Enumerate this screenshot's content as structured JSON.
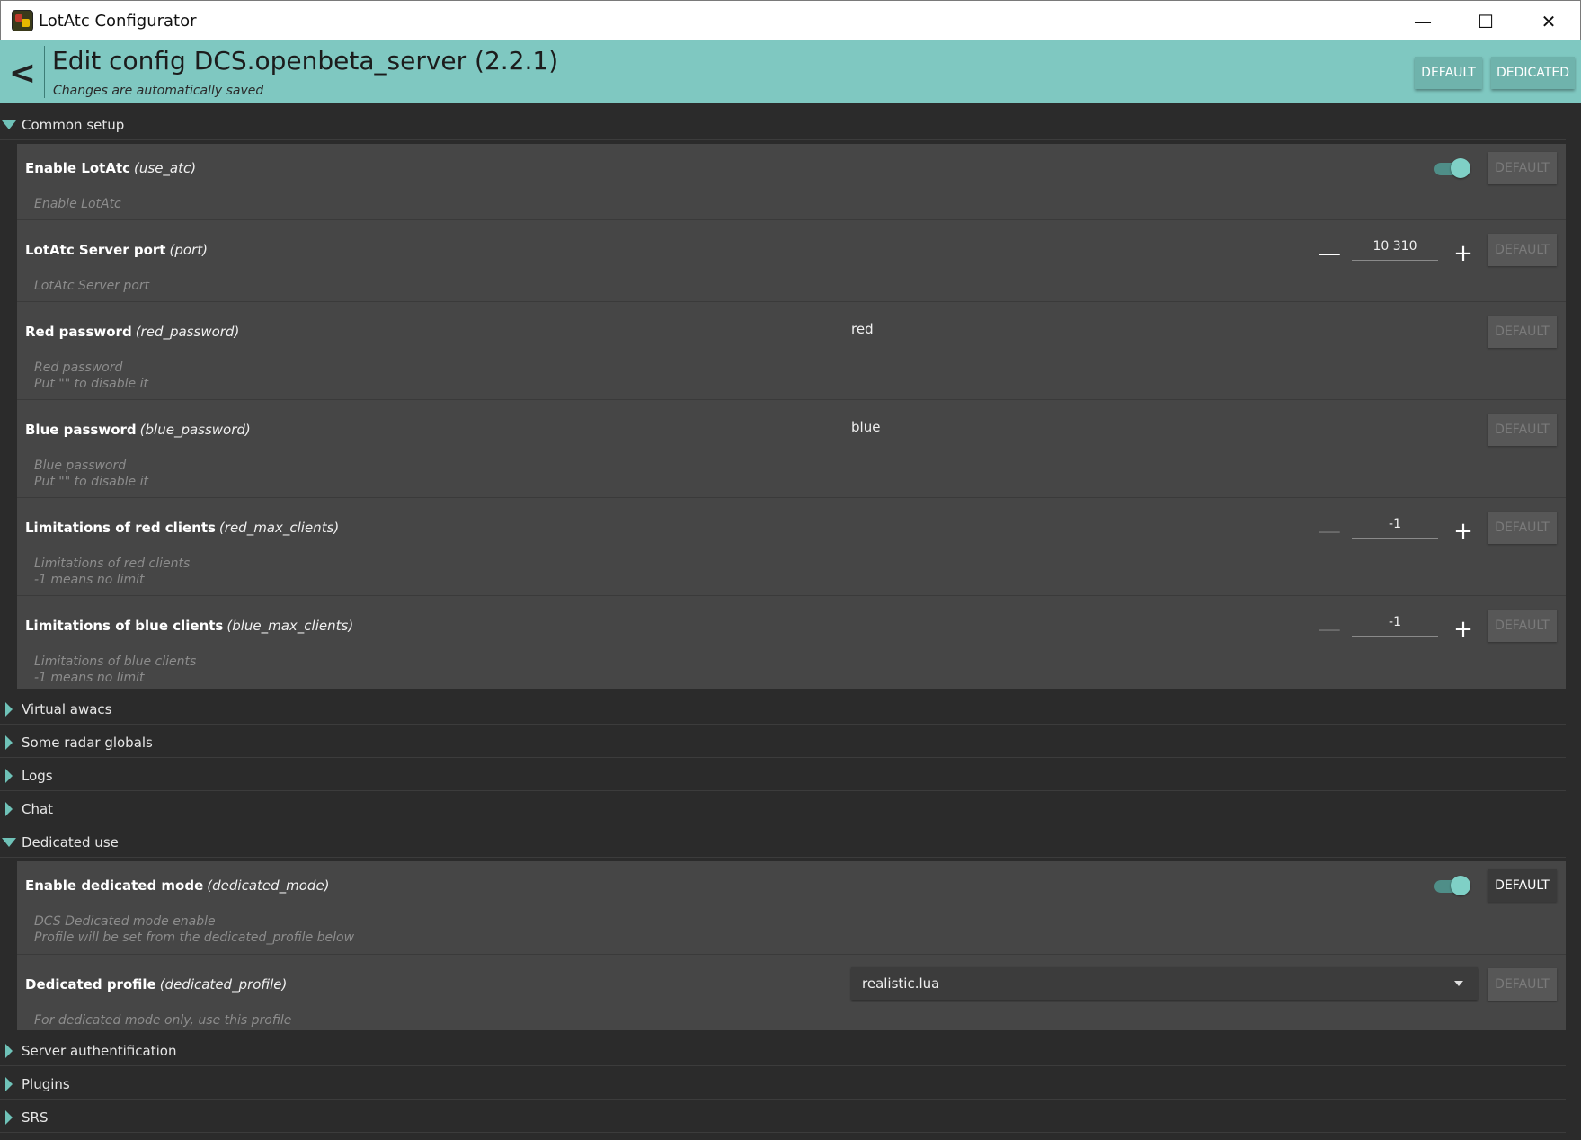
{
  "window": {
    "title": "LotAtc Configurator",
    "minimize_glyph": "—",
    "maximize_glyph": "☐",
    "close_glyph": "✕"
  },
  "header": {
    "back_glyph": "<",
    "title": "Edit config DCS.openbeta_server (2.2.1)",
    "subtitle": "Changes are automatically saved",
    "default_button": "DEFAULT",
    "dedicated_button": "DEDICATED",
    "accent_color": "#7fc8c1"
  },
  "sections": {
    "common": {
      "label": "Common setup",
      "settings": {
        "use_atc": {
          "title": "Enable LotAtc",
          "key": "(use_atc)",
          "desc1": "Enable LotAtc",
          "enabled": true,
          "default_label": "DEFAULT"
        },
        "port": {
          "title": "LotAtc Server port",
          "key": "(port)",
          "desc1": "LotAtc Server port",
          "value": "10 310",
          "minus": "—",
          "plus": "+",
          "default_label": "DEFAULT"
        },
        "red_password": {
          "title": "Red password",
          "key": "(red_password)",
          "desc1": "Red password",
          "desc2": "Put \"\" to disable it",
          "value": "red",
          "default_label": "DEFAULT"
        },
        "blue_password": {
          "title": "Blue password",
          "key": "(blue_password)",
          "desc1": "Blue password",
          "desc2": "Put \"\" to disable it",
          "value": "blue",
          "default_label": "DEFAULT"
        },
        "red_max_clients": {
          "title": "Limitations of red clients",
          "key": "(red_max_clients)",
          "desc1": "Limitations of red clients",
          "desc2": "-1 means no limit",
          "value": "-1",
          "minus": "—",
          "plus": "+",
          "default_label": "DEFAULT"
        },
        "blue_max_clients": {
          "title": "Limitations of blue clients",
          "key": "(blue_max_clients)",
          "desc1": "Limitations of blue clients",
          "desc2": "-1 means no limit",
          "value": "-1",
          "minus": "—",
          "plus": "+",
          "default_label": "DEFAULT"
        }
      }
    },
    "virtual_awacs": {
      "label": "Virtual awacs"
    },
    "radar_globals": {
      "label": "Some radar globals"
    },
    "logs": {
      "label": "Logs"
    },
    "chat": {
      "label": "Chat"
    },
    "dedicated": {
      "label": "Dedicated use",
      "settings": {
        "dedicated_mode": {
          "title": "Enable dedicated mode",
          "key": "(dedicated_mode)",
          "desc1": "DCS Dedicated mode enable",
          "desc2": "Profile will be set from the dedicated_profile below",
          "enabled": true,
          "default_label": "DEFAULT"
        },
        "dedicated_profile": {
          "title": "Dedicated profile",
          "key": "(dedicated_profile)",
          "desc1": "For dedicated mode only, use this profile",
          "selected": "realistic.lua",
          "default_label": "DEFAULT"
        }
      }
    },
    "server_auth": {
      "label": "Server authentification"
    },
    "plugins": {
      "label": "Plugins"
    },
    "srs": {
      "label": "SRS"
    }
  }
}
